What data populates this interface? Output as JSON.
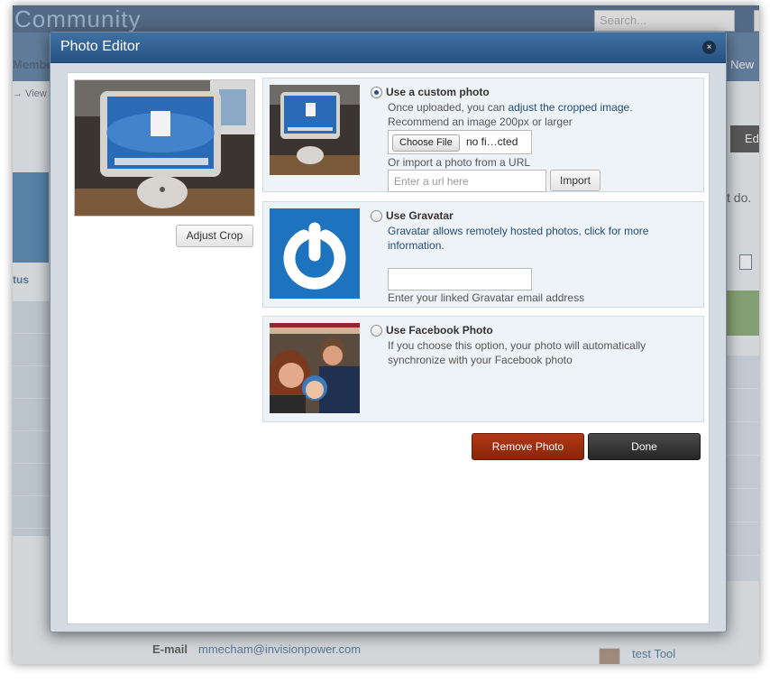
{
  "background": {
    "brand": "Community",
    "search_placeholder": "Search...",
    "members_tab": "Membe",
    "new_tab": "v New",
    "breadcrumb": "→ View",
    "status_tab": "tus",
    "edit_button": "Ed",
    "snippet": "t do.",
    "email_label": "E-mail",
    "email_value": "mmecham@invisionpower.com",
    "tool_link": "test Tool"
  },
  "modal": {
    "title": "Photo Editor",
    "close_icon": "×",
    "adjust_crop_label": "Adjust Crop",
    "custom": {
      "label": "Use a custom photo",
      "line1_prefix": "Once uploaded, you can ",
      "line1_link": "adjust the cropped image",
      "line1_suffix": ".",
      "line2": "Recommend an image 200px or larger",
      "choose_file_label": "Choose File",
      "file_text": "no fi…cted",
      "url_prompt": "Or import a photo from a URL",
      "url_placeholder": "Enter a url here",
      "import_label": "Import",
      "selected": true
    },
    "gravatar": {
      "label": "Use Gravatar",
      "line1": "Gravatar allows remotely hosted photos, click for more",
      "line2": "information.",
      "email_hint": "Enter your linked Gravatar email address",
      "selected": false
    },
    "facebook": {
      "label": "Use Facebook Photo",
      "line1": "If you choose this option, your photo will automatically",
      "line2": "synchronize with your Facebook photo",
      "selected": false
    },
    "remove_label": "Remove Photo",
    "done_label": "Done"
  },
  "colors": {
    "titlebar": "#2f5e90",
    "remove": "#9c2f0e",
    "done": "#333333",
    "link": "#1e4d7d"
  },
  "icons": [
    "close-icon",
    "radio-icon",
    "gravatar-icon",
    "document-icon"
  ]
}
